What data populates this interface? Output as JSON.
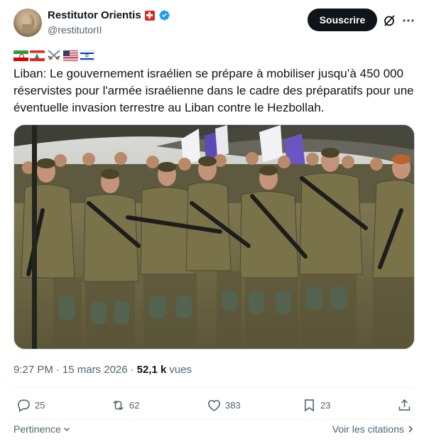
{
  "author": {
    "name": "Restitutor Orientis",
    "handle": "@restitutorII",
    "avatar_icon": "statue-bust-avatar",
    "badges": [
      "swiss-flag-icon",
      "verified-badge-icon"
    ]
  },
  "header": {
    "subscribe_label": "Souscrire",
    "grok_icon": "grok-slash-icon",
    "more_icon": "more-dots-icon"
  },
  "tweet": {
    "emoji_flags": [
      "iran-flag",
      "lebanon-flag",
      "crossed-swords",
      "usa-flag",
      "israel-flag"
    ],
    "text": "Liban: Le gouvernement israélien se prépare à mobiliser jusqu’à 450 000 réservistes pour l'armée israélienne dans le cadre des préparatifs pour une éventuelle invasion terrestre au Liban contre le Hezbollah.",
    "image_icon": "soldiers-photo"
  },
  "meta": {
    "time": "9:27 PM",
    "separator": "·",
    "date": "15 mars 2026",
    "views_count": "52,1 k",
    "views_label": "vues"
  },
  "actions": {
    "replies": "25",
    "reposts": "62",
    "likes": "383",
    "bookmarks": "23"
  },
  "footer": {
    "relevance_label": "Pertinence",
    "quotes_label": "Voir les citations"
  },
  "colors": {
    "text": "#0f1419",
    "secondary": "#536471",
    "button_bg": "#0f1419",
    "verified": "#1d9bf0",
    "divider": "#eff3f4"
  }
}
